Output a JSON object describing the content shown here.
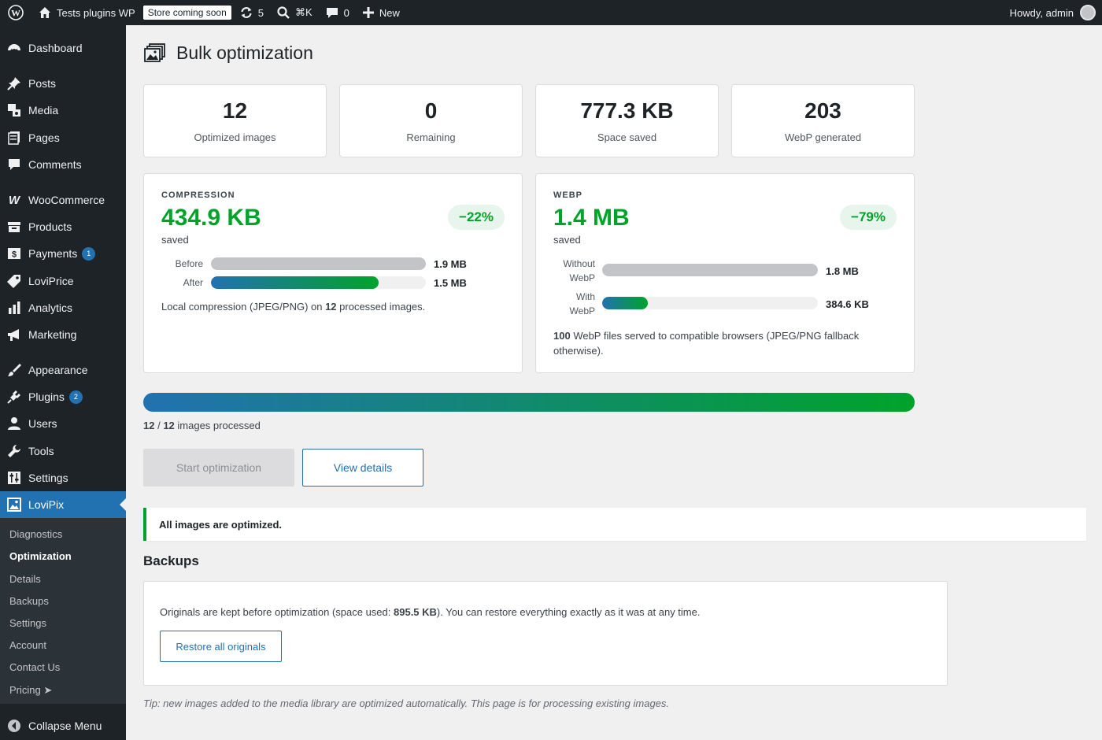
{
  "adminbar": {
    "site_name": "Tests plugins WP",
    "store_badge": "Store coming soon",
    "updates_count": "5",
    "search_shortcut": "⌘K",
    "comments_count": "0",
    "new_label": "New",
    "howdy": "Howdy, admin"
  },
  "sidebar": {
    "items": {
      "dashboard": "Dashboard",
      "posts": "Posts",
      "media": "Media",
      "pages": "Pages",
      "comments": "Comments",
      "woocommerce": "WooCommerce",
      "products": "Products",
      "payments": "Payments",
      "payments_badge": "1",
      "loviprice": "LoviPrice",
      "analytics": "Analytics",
      "marketing": "Marketing",
      "appearance": "Appearance",
      "plugins": "Plugins",
      "plugins_badge": "2",
      "users": "Users",
      "tools": "Tools",
      "settings": "Settings",
      "lovipix": "LoviPix"
    },
    "submenu": {
      "diagnostics": "Diagnostics",
      "optimization": "Optimization",
      "details": "Details",
      "backups": "Backups",
      "settings": "Settings",
      "account": "Account",
      "contact": "Contact Us",
      "pricing": "Pricing ➤"
    },
    "collapse": "Collapse Menu"
  },
  "page": {
    "title": "Bulk optimization"
  },
  "stats": {
    "optimized": {
      "value": "12",
      "label": "Optimized images"
    },
    "remaining": {
      "value": "0",
      "label": "Remaining"
    },
    "space": {
      "value": "777.3 KB",
      "label": "Space saved"
    },
    "webp": {
      "value": "203",
      "label": "WebP generated"
    }
  },
  "compression": {
    "caption": "COMPRESSION",
    "amount": "434.9 KB",
    "saved": "saved",
    "percent": "−22%",
    "before_label": "Before",
    "before_value": "1.9 MB",
    "before_fill": 1.0,
    "after_label": "After",
    "after_value": "1.5 MB",
    "after_fill": 0.78,
    "note_a": "Local compression (JPEG/PNG) on ",
    "note_b": "12",
    "note_c": " processed images."
  },
  "webp_panel": {
    "caption": "WEBP",
    "amount": "1.4 MB",
    "saved": "saved",
    "percent": "−79%",
    "without_label_1": "Without",
    "without_label_2": "WebP",
    "without_value": "1.8 MB",
    "without_fill": 1.0,
    "with_label_1": "With",
    "with_label_2": "WebP",
    "with_value": "384.6 KB",
    "with_fill": 0.21,
    "note_a": "100",
    "note_b": " WebP files served to compatible browsers (JPEG/PNG fallback",
    "note_c": "otherwise)."
  },
  "progress": {
    "fraction": 1.0,
    "done": "12",
    "sep": " / ",
    "total": "12",
    "suffix": " images processed"
  },
  "buttons": {
    "start": "Start optimization",
    "view": "View details"
  },
  "notice": "All images are optimized.",
  "backups": {
    "title": "Backups",
    "text_a": "Originals are kept before optimization (space used: ",
    "text_b": "895.5 KB",
    "text_c": "). You can restore everything exactly as it was at any time.",
    "restore": "Restore all originals"
  },
  "tip": "Tip: new images added to the media library are optimized automatically. This page is for processing existing images."
}
